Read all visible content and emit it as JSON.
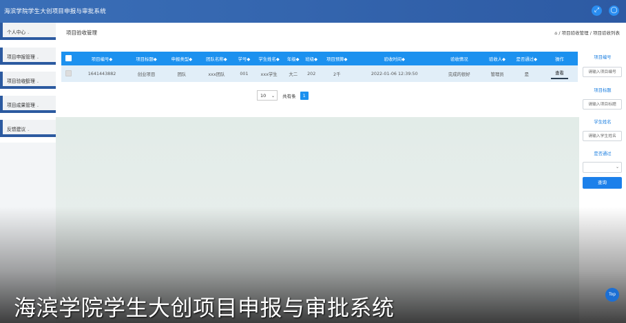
{
  "header": {
    "title": "海滨学院学生大创项目申报与审批系统",
    "fullscreen_icon": "expand-icon",
    "user_icon": "user-icon"
  },
  "sidebar": {
    "items": [
      {
        "label": "个人中心"
      },
      {
        "label": "项目申报管理"
      },
      {
        "label": "项目验收管理"
      },
      {
        "label": "项目成果管理"
      },
      {
        "label": "反馈建议"
      }
    ]
  },
  "breadcrumb": {
    "page_title": "项目验收管理",
    "path": "⌂ / 项目验收管理 / 项目验收列表"
  },
  "table": {
    "columns": [
      "项目编号◆",
      "项目标题◆",
      "申报类型◆",
      "团队名称◆",
      "学号◆",
      "学生姓名◆",
      "年级◆",
      "班级◆",
      "项目预算◆",
      "验收时间◆",
      "验收情况",
      "验收人◆",
      "是否通过◆",
      "操作"
    ],
    "rows": [
      {
        "id": "1641443882",
        "title": "创业项目",
        "type": "团队",
        "team": "xxx团队",
        "student_no": "001",
        "student_name": "xxx学生",
        "grade": "大二",
        "class": "202",
        "budget": "2千",
        "time": "2022-01-06 12:39:50",
        "status": "完成的很好",
        "checker": "管理员",
        "passed": "是",
        "action": "查看"
      }
    ]
  },
  "pagination": {
    "page_size": "10",
    "total": "共有条",
    "current_page": "1"
  },
  "filters": {
    "project_no_label": "项目编号",
    "project_no_placeholder": "请输入项目编号",
    "project_title_label": "项目标题",
    "project_title_placeholder": "请输入项目标题",
    "student_name_label": "学生姓名",
    "student_name_placeholder": "请输入学生姓名",
    "passed_label": "是否通过",
    "query_button": "查询"
  },
  "caption": "海滨学院学生大创项目申报与审批系统",
  "back_to_top": "Top"
}
